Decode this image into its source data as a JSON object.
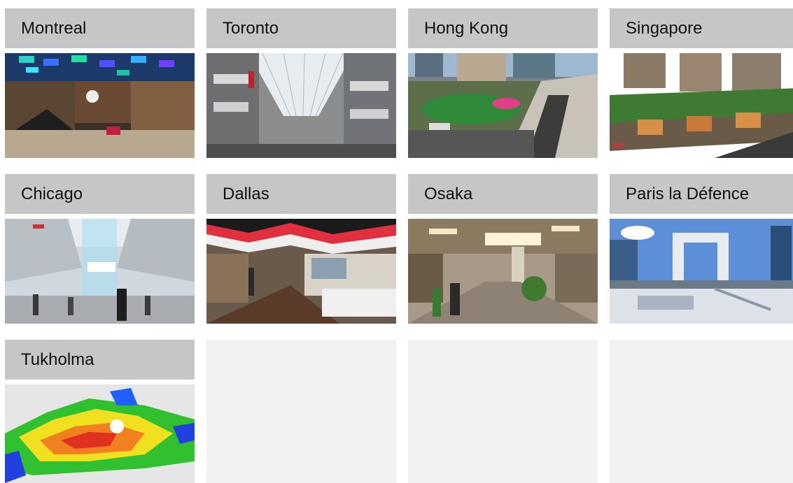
{
  "cities": [
    {
      "key": "montreal",
      "label": "Montreal"
    },
    {
      "key": "toronto",
      "label": "Toronto"
    },
    {
      "key": "hongkong",
      "label": "Hong Kong"
    },
    {
      "key": "singapore",
      "label": "Singapore"
    },
    {
      "key": "chicago",
      "label": "Chicago"
    },
    {
      "key": "dallas",
      "label": "Dallas"
    },
    {
      "key": "osaka",
      "label": "Osaka"
    },
    {
      "key": "paris",
      "label": "Paris la Défence"
    },
    {
      "key": "tukholma",
      "label": "Tukholma"
    }
  ],
  "colors": {
    "label_bar": "#c6c6c6",
    "empty_tile": "#f2f2f2",
    "label_text": "#111111"
  }
}
